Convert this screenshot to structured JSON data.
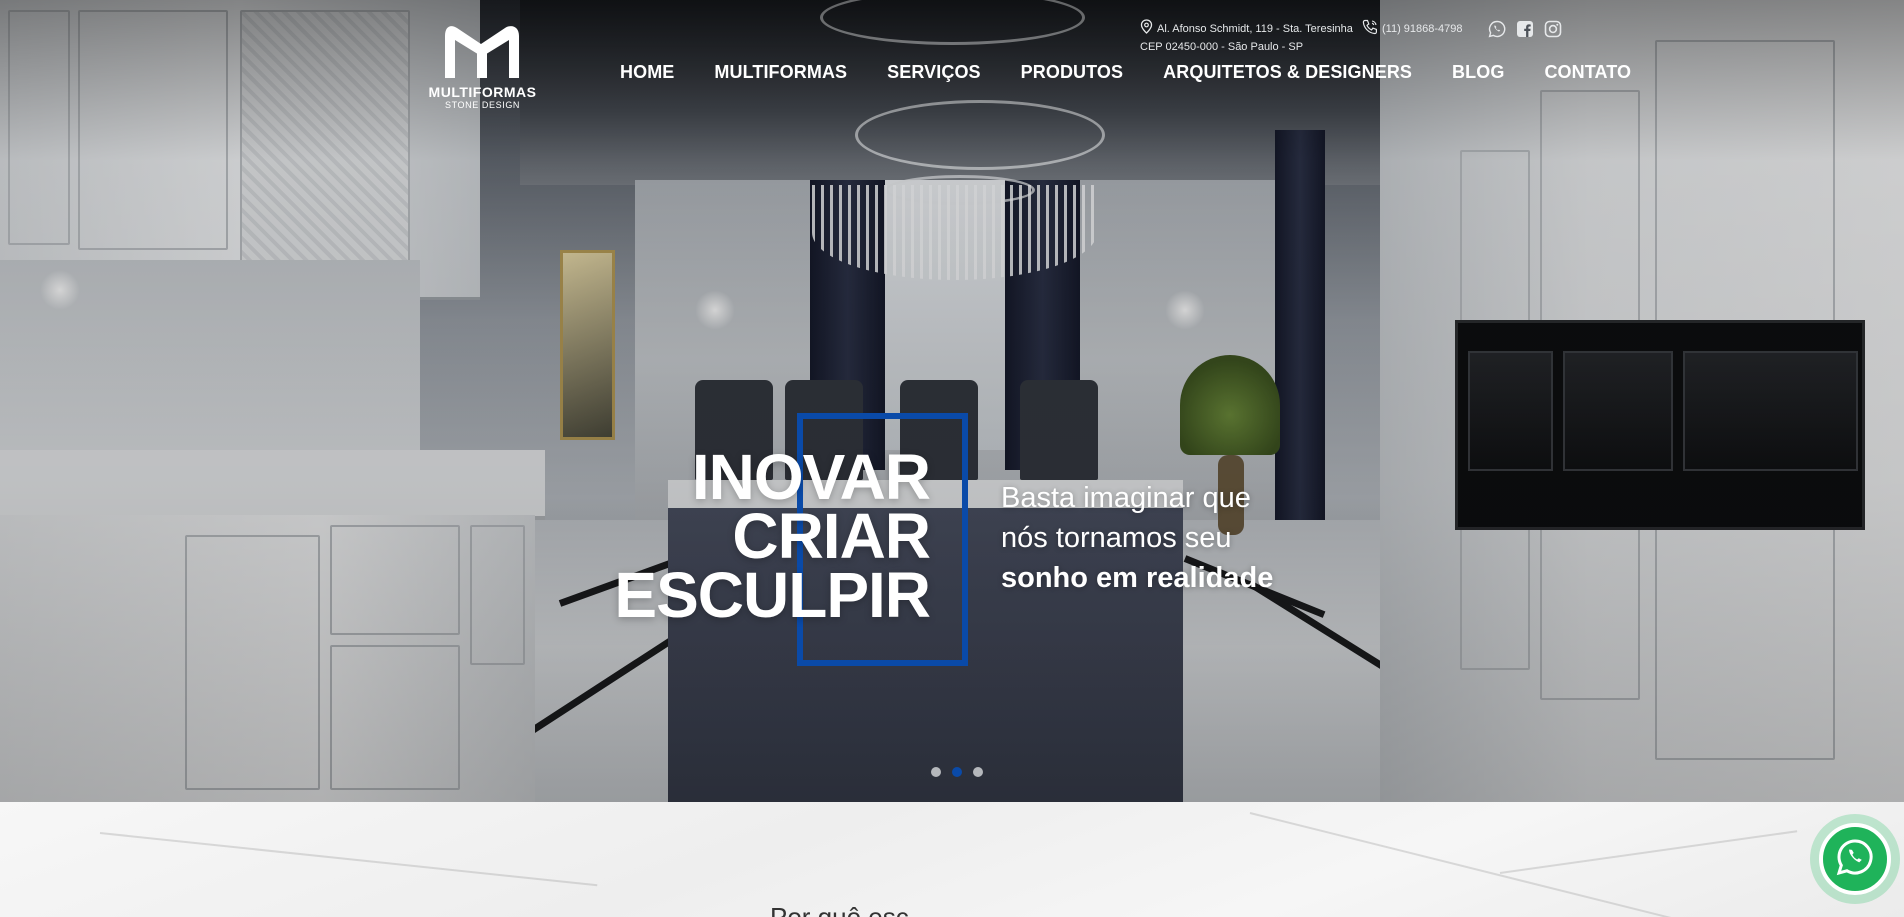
{
  "header": {
    "logo": {
      "name": "MULTIFORMAS",
      "subtitle": "STONE DESIGN"
    },
    "nav": [
      {
        "label": "HOME"
      },
      {
        "label": "MULTIFORMAS"
      },
      {
        "label": "SERVIÇOS"
      },
      {
        "label": "PRODUTOS"
      },
      {
        "label": "ARQUITETOS & DESIGNERS"
      },
      {
        "label": "BLOG"
      },
      {
        "label": "CONTATO"
      }
    ],
    "address_line1": "Al. Afonso Schmidt, 119 - Sta. Teresinha",
    "address_line2": "CEP 02450-000 - São Paulo - SP",
    "phone": "(11) 91868-4798",
    "social_icons": [
      "whatsapp-icon",
      "facebook-icon",
      "instagram-icon"
    ]
  },
  "hero": {
    "words": [
      "INOVAR",
      "CRIAR",
      "ESCULPIR"
    ],
    "tagline_line1": "Basta imaginar que",
    "tagline_line2": "nós tornamos seu",
    "tagline_bold": "sonho em realidade",
    "slides_total": 3,
    "active_slide": 2
  },
  "section": {
    "heading_partial": "Por quê esc..."
  },
  "colors": {
    "accent": "#0a4aa8",
    "whatsapp": "#1fb35a",
    "text_light": "#ffffff"
  }
}
